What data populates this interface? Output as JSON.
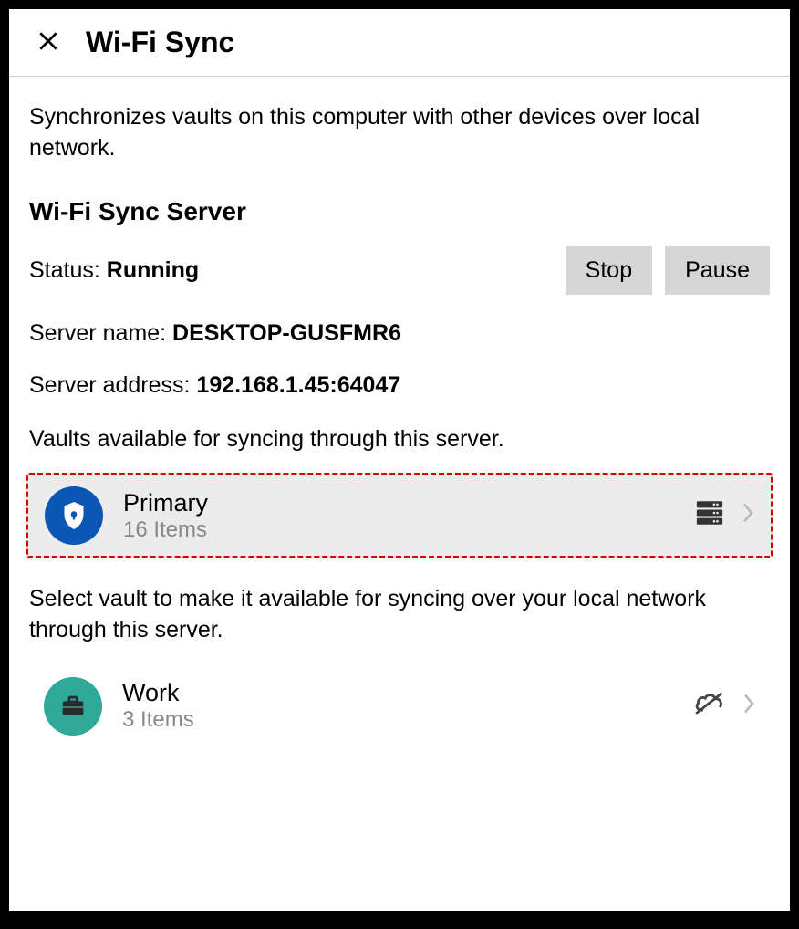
{
  "header": {
    "title": "Wi-Fi Sync"
  },
  "description": "Synchronizes vaults on this computer with other devices over local network.",
  "server": {
    "section_title": "Wi-Fi Sync Server",
    "status_label": "Status: ",
    "status_value": "Running",
    "stop_label": "Stop",
    "pause_label": "Pause",
    "name_label": "Server name: ",
    "name_value": "DESKTOP-GUSFMR6",
    "address_label": "Server address: ",
    "address_value": "192.168.1.45:64047"
  },
  "available_desc": "Vaults available for syncing through this server.",
  "vaults_available": [
    {
      "name": "Primary",
      "items": "16 Items"
    }
  ],
  "select_desc": "Select vault to make it available for syncing over your local network through this server.",
  "vaults_selectable": [
    {
      "name": "Work",
      "items": "3 Items"
    }
  ]
}
